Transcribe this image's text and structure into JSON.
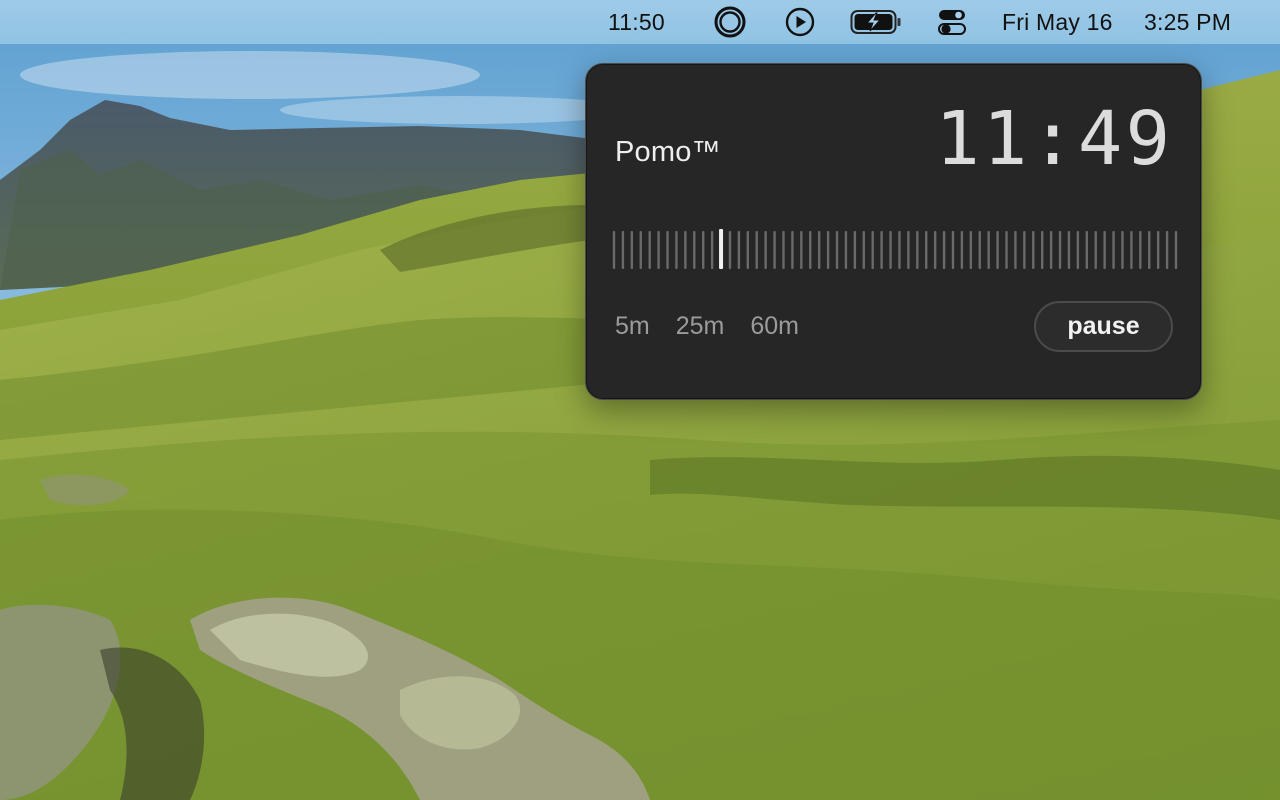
{
  "menubar": {
    "timer": "11:50",
    "icons": {
      "ring": "ring-icon",
      "play": "play-circle-icon",
      "battery": "battery-charging-icon",
      "control_center": "control-center-icon"
    },
    "date": "Fri May 16",
    "time": "3:25 PM"
  },
  "pomo": {
    "title": "Pomo™",
    "remaining": "11:49",
    "progress": {
      "tick_count": 64,
      "current_tick": 12
    },
    "presets": [
      "5m",
      "25m",
      "60m"
    ],
    "pause_label": "pause",
    "colors": {
      "background": "#262626",
      "tick": "#6a6a6a",
      "tick_active": "#f2f2f2"
    }
  }
}
